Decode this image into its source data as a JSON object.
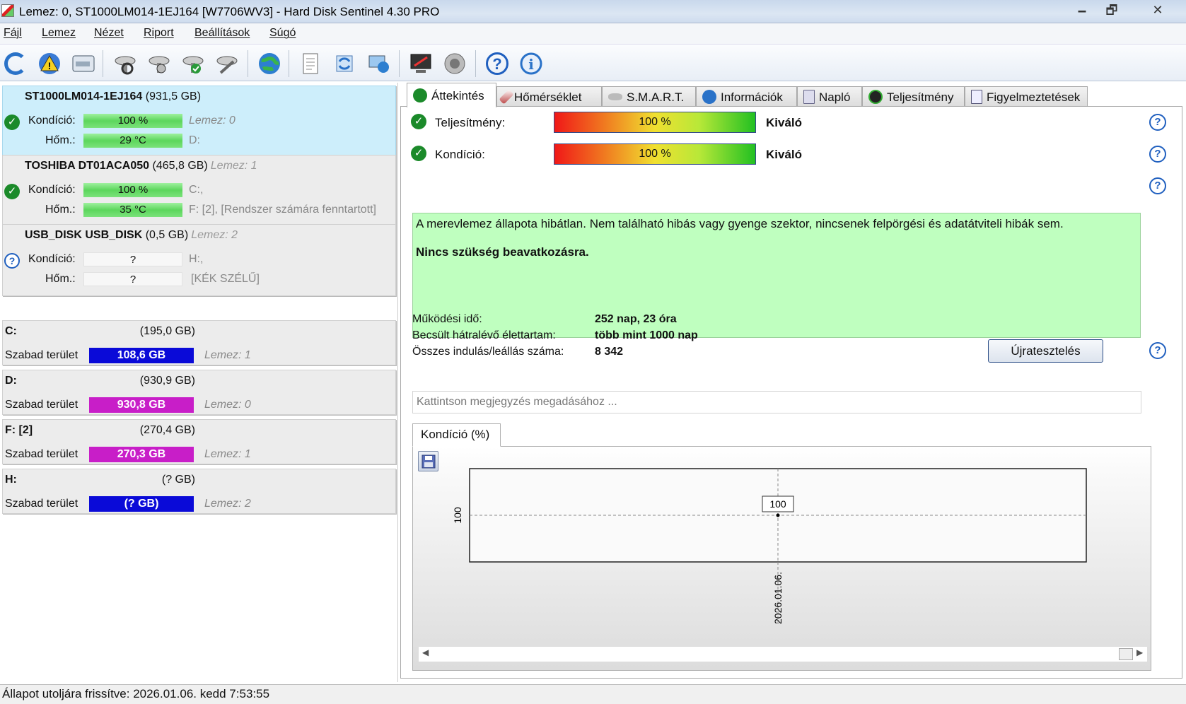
{
  "window": {
    "title": "Lemez: 0, ST1000LM014-1EJ164 [W7706WV3]  -  Hard Disk Sentinel 4.30 PRO",
    "minimize": "🗕",
    "maximize": "🗗",
    "close": "✕"
  },
  "menu": [
    "Fájl",
    "Lemez",
    "Nézet",
    "Riport",
    "Beállítások",
    "Súgó"
  ],
  "disks": [
    {
      "name": "ST1000LM014-1EJ164",
      "size": "(931,5 GB)",
      "lemez": "",
      "status_icon": "ok",
      "kondicio_label": "Kondíció:",
      "kondicio_value": "100 %",
      "hom_label": "Hőm.:",
      "hom_value": "29 °C",
      "extra1": "Lemez: 0",
      "extra2": "D:"
    },
    {
      "name": "TOSHIBA DT01ACA050",
      "size": "(465,8 GB)",
      "lemez": "Lemez: 1",
      "status_icon": "ok",
      "kondicio_label": "Kondíció:",
      "kondicio_value": "100 %",
      "hom_label": "Hőm.:",
      "hom_value": "35 °C",
      "extra1": "C:,",
      "extra2": "F: [2],  [Rendszer számára fenntartott]"
    },
    {
      "name": "USB_DISK USB_DISK",
      "size": "(0,5 GB)",
      "lemez": "Lemez: 2",
      "status_icon": "unknown",
      "kondicio_label": "Kondíció:",
      "kondicio_value": "?",
      "hom_label": "Hőm.:",
      "hom_value": "?",
      "extra1": "H:,",
      "extra2": "[KÉK SZÉLŰ]"
    }
  ],
  "volumes": [
    {
      "name": "C:",
      "size": "(195,0 GB)",
      "free_label": "Szabad terület",
      "free": "108,6 GB",
      "lemez": "Lemez: 1",
      "color": "#0a0ad8"
    },
    {
      "name": "D:",
      "size": "(930,9 GB)",
      "free_label": "Szabad terület",
      "free": "930,8 GB",
      "lemez": "Lemez: 0",
      "color": "#c81ec8"
    },
    {
      "name": "F: [2]",
      "size": "(270,4 GB)",
      "free_label": "Szabad terület",
      "free": "270,3 GB",
      "lemez": "Lemez: 1",
      "color": "#c81ec8"
    },
    {
      "name": "H:",
      "size": "(? GB)",
      "free_label": "Szabad terület",
      "free": "(? GB)",
      "lemez": "Lemez: 2",
      "color": "#0a0ad8"
    }
  ],
  "tabs": [
    "Áttekintés",
    "Hőmérséklet",
    "S.M.A.R.T.",
    "Információk",
    "Napló",
    "Teljesítmény",
    "Figyelmeztetések"
  ],
  "overview": {
    "teljesitmeny_label": "Teljesítmény:",
    "teljesitmeny_value": "100 %",
    "teljesitmeny_rating": "Kiváló",
    "kondicio_label": "Kondíció:",
    "kondicio_value": "100 %",
    "kondicio_rating": "Kiváló",
    "status_text": "A merevlemez állapota hibátlan. Nem található hibás vagy gyenge szektor, nincsenek felpörgési és adatátviteli hibák sem.",
    "status_action": "Nincs szükség beavatkozásra.",
    "uptime_label": "Működési idő:",
    "uptime_value": "252 nap, 23 óra",
    "lifetime_label": "Becsült hátralévő élettartam:",
    "lifetime_value": "több mint 1000 nap",
    "starts_label": "Összes indulás/leállás száma:",
    "starts_value": "8 342",
    "retest_button": "Újratesztelés",
    "note_placeholder": "Kattintson megjegyzés megadásához ..."
  },
  "chart_tab": "Kondíció  (%)",
  "chart_data": {
    "type": "line",
    "x": [
      "2026.01.06."
    ],
    "series": [
      {
        "values": [
          100
        ]
      }
    ],
    "ytick_labels": [
      "100"
    ],
    "data_labels": [
      "100"
    ],
    "grid": true
  },
  "statusbar": "Állapot utoljára frissítve: 2026.01.06. kedd 7:53:55",
  "colors": {
    "ok": "#1b8a2a",
    "help": "#1f5fbf",
    "status_bg": "#bfffbf"
  }
}
